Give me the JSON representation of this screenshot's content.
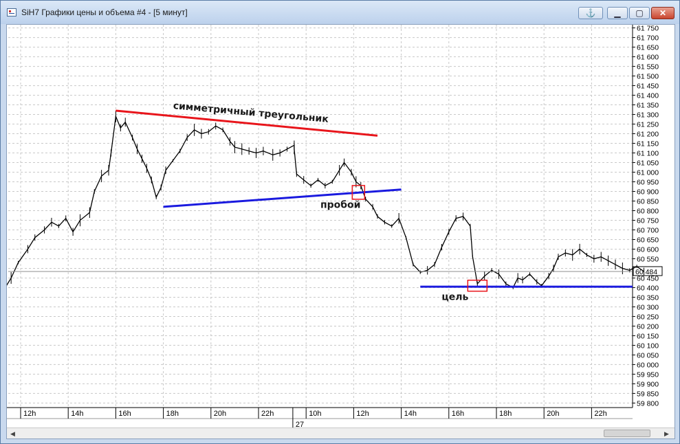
{
  "window": {
    "title": "SiH7 Графики цены и объема #4 - [5 минут]",
    "buttons": {
      "pin": "⚓",
      "minimize": "▁",
      "restore": "▢",
      "close": "✕"
    }
  },
  "chart_data": {
    "type": "line",
    "style": "candlestick-bars",
    "current_price": "60 484",
    "current_value": 60484,
    "ylim": [
      59780,
      61770
    ],
    "y_ticks": [
      "61 750",
      "61 700",
      "61 650",
      "61 600",
      "61 550",
      "61 500",
      "61 450",
      "61 400",
      "61 350",
      "61 300",
      "61 250",
      "61 200",
      "61 150",
      "61 100",
      "61 050",
      "61 000",
      "60 950",
      "60 900",
      "60 850",
      "60 800",
      "60 750",
      "60 700",
      "60 650",
      "60 600",
      "60 550",
      "60 500",
      "60 450",
      "60 400",
      "60 350",
      "60 300",
      "60 250",
      "60 200",
      "60 150",
      "60 100",
      "60 050",
      "60 000",
      "59 950",
      "59 900",
      "59 850",
      "59 800"
    ],
    "y_tick_values": [
      61750,
      61700,
      61650,
      61600,
      61550,
      61500,
      61450,
      61400,
      61350,
      61300,
      61250,
      61200,
      61150,
      61100,
      61050,
      61000,
      60950,
      60900,
      60850,
      60800,
      60750,
      60700,
      60650,
      60600,
      60550,
      60500,
      60450,
      60400,
      60350,
      60300,
      60250,
      60200,
      60150,
      60100,
      60050,
      60000,
      59950,
      59900,
      59850,
      59800
    ],
    "x_ticks": [
      "12h",
      "14h",
      "16h",
      "18h",
      "20h",
      "22h",
      "10h",
      "12h",
      "14h",
      "16h",
      "18h",
      "20h",
      "22h"
    ],
    "x_tick_hours": [
      12,
      14,
      16,
      18,
      20,
      22,
      34,
      36,
      38,
      40,
      42,
      44,
      46
    ],
    "date_label": "27",
    "date_label_hour": 33.2,
    "xlim": [
      11.3,
      37.3
    ],
    "price_series": [
      [
        11.3,
        60390
      ],
      [
        11.6,
        60450
      ],
      [
        11.9,
        60530
      ],
      [
        12.3,
        60600
      ],
      [
        12.6,
        60660
      ],
      [
        13.0,
        60700
      ],
      [
        13.3,
        60740
      ],
      [
        13.6,
        60720
      ],
      [
        13.9,
        60760
      ],
      [
        14.2,
        60690
      ],
      [
        14.5,
        60750
      ],
      [
        14.9,
        60790
      ],
      [
        15.1,
        60900
      ],
      [
        15.4,
        60980
      ],
      [
        15.7,
        61010
      ],
      [
        15.8,
        61100
      ],
      [
        16.0,
        61290
      ],
      [
        16.2,
        61230
      ],
      [
        16.4,
        61260
      ],
      [
        16.7,
        61180
      ],
      [
        16.9,
        61120
      ],
      [
        17.1,
        61070
      ],
      [
        17.3,
        61020
      ],
      [
        17.5,
        60960
      ],
      [
        17.7,
        60870
      ],
      [
        17.9,
        60920
      ],
      [
        18.1,
        61010
      ],
      [
        18.4,
        61060
      ],
      [
        18.7,
        61110
      ],
      [
        19.0,
        61180
      ],
      [
        19.3,
        61220
      ],
      [
        19.6,
        61200
      ],
      [
        19.9,
        61210
      ],
      [
        20.2,
        61240
      ],
      [
        20.5,
        61220
      ],
      [
        20.8,
        61160
      ],
      [
        21.0,
        61130
      ],
      [
        21.3,
        61120
      ],
      [
        21.6,
        61110
      ],
      [
        21.9,
        61100
      ],
      [
        22.2,
        61110
      ],
      [
        22.6,
        61090
      ],
      [
        22.9,
        61100
      ],
      [
        23.2,
        61120
      ],
      [
        23.5,
        61140
      ],
      [
        33.5,
        61120
      ],
      [
        33.6,
        60990
      ],
      [
        33.9,
        60960
      ],
      [
        34.2,
        60930
      ],
      [
        34.5,
        60960
      ],
      [
        34.8,
        60930
      ],
      [
        35.1,
        60950
      ],
      [
        35.4,
        61010
      ],
      [
        35.6,
        61050
      ],
      [
        35.9,
        61000
      ],
      [
        36.1,
        60950
      ],
      [
        36.3,
        60930
      ],
      [
        36.5,
        60860
      ],
      [
        36.8,
        60820
      ],
      [
        37.0,
        60770
      ],
      [
        37.3,
        60740
      ],
      [
        37.6,
        60720
      ],
      [
        37.9,
        60760
      ],
      [
        38.2,
        60660
      ],
      [
        38.5,
        60520
      ],
      [
        38.8,
        60480
      ],
      [
        39.1,
        60490
      ],
      [
        39.4,
        60520
      ],
      [
        39.7,
        60610
      ],
      [
        40.0,
        60690
      ],
      [
        40.3,
        60760
      ],
      [
        40.6,
        60770
      ],
      [
        40.9,
        60720
      ],
      [
        41.0,
        60560
      ],
      [
        41.2,
        60420
      ],
      [
        41.5,
        60460
      ],
      [
        41.8,
        60490
      ],
      [
        42.1,
        60470
      ],
      [
        42.4,
        60420
      ],
      [
        42.7,
        60400
      ],
      [
        42.9,
        60450
      ],
      [
        43.1,
        60440
      ],
      [
        43.4,
        60470
      ],
      [
        43.7,
        60430
      ],
      [
        43.9,
        60410
      ],
      [
        44.2,
        60460
      ],
      [
        44.4,
        60500
      ],
      [
        44.6,
        60560
      ],
      [
        44.9,
        60580
      ],
      [
        45.2,
        60570
      ],
      [
        45.5,
        60600
      ],
      [
        45.8,
        60570
      ],
      [
        46.1,
        60550
      ],
      [
        46.4,
        60560
      ],
      [
        46.7,
        60540
      ],
      [
        47.0,
        60520
      ],
      [
        47.3,
        60500
      ],
      [
        47.6,
        60490
      ],
      [
        47.9,
        60510
      ],
      [
        48.2,
        60484
      ]
    ],
    "annotations": {
      "triangle_label": "симметричный треугольник",
      "breakout_label": "пробой",
      "target_label": "цель"
    },
    "colors": {
      "price": "#000000",
      "resistance_line": "#e8151b",
      "support_line": "#1a1adf",
      "target_line": "#1a1adf",
      "marker": "#e8151b",
      "grid": "#c8c8c8",
      "current_line": "#8c8c8c"
    }
  },
  "scrollbar": {
    "left_arrow": "◀",
    "right_arrow": "▶"
  }
}
